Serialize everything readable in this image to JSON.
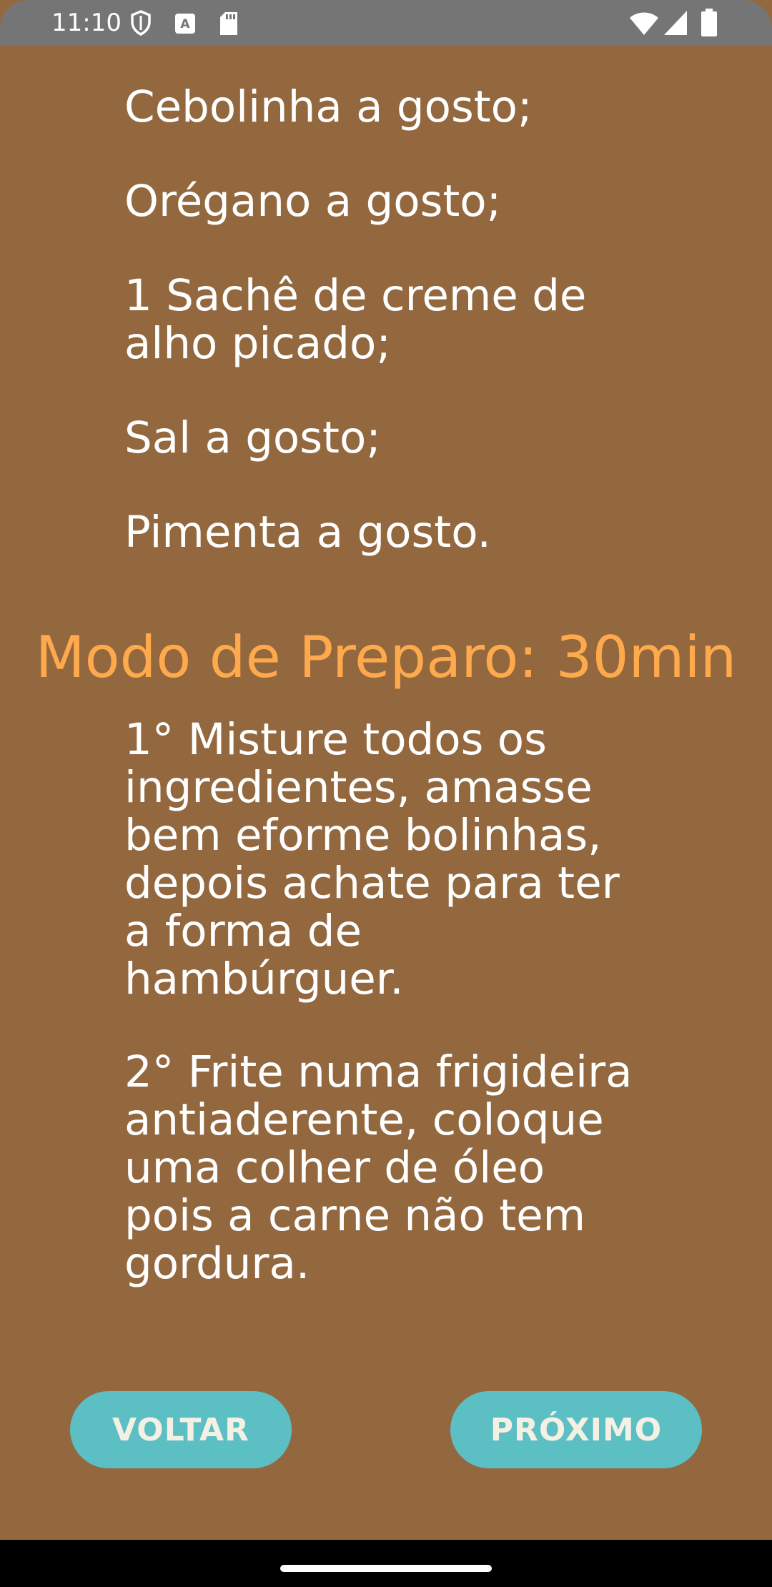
{
  "status_bar": {
    "time": "11:10",
    "icons_left": [
      "shield-icon",
      "font-icon",
      "sd-card-icon"
    ],
    "icons_right": [
      "wifi-icon",
      "signal-icon",
      "battery-icon"
    ]
  },
  "ingredients": [
    "Cebolinha a gosto;",
    "Orégano a gosto;",
    "1 Sachê de creme de\nalho picado;",
    "Sal a gosto;",
    "Pimenta a gosto."
  ],
  "preparation": {
    "title": "Modo de Preparo: 30min",
    "steps": [
      "1° Misture todos os\ningredientes, amasse\nbem eforme bolinhas,\ndepois achate para ter\na forma de\nhambúrguer.",
      "2° Frite numa frigideira\nantiaderente, coloque\numa colher de óleo\npois a carne não tem\ngordura."
    ]
  },
  "buttons": {
    "back_label": "VOLTAR",
    "next_label": "PRÓXIMO"
  },
  "colors": {
    "background": "#93683f",
    "title": "#ffa94d",
    "button": "#5bbfc4",
    "status_bar": "#757575"
  }
}
